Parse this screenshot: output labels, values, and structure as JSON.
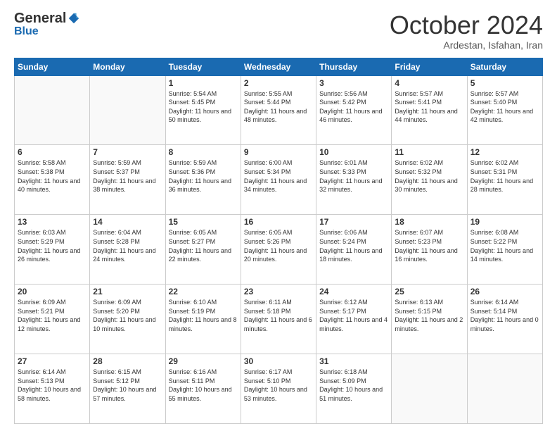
{
  "header": {
    "logo": {
      "general": "General",
      "blue": "Blue"
    },
    "title": "October 2024",
    "location": "Ardestan, Isfahan, Iran"
  },
  "days_of_week": [
    "Sunday",
    "Monday",
    "Tuesday",
    "Wednesday",
    "Thursday",
    "Friday",
    "Saturday"
  ],
  "weeks": [
    [
      {
        "day": "",
        "sunrise": "",
        "sunset": "",
        "daylight": ""
      },
      {
        "day": "",
        "sunrise": "",
        "sunset": "",
        "daylight": ""
      },
      {
        "day": "1",
        "sunrise": "Sunrise: 5:54 AM",
        "sunset": "Sunset: 5:45 PM",
        "daylight": "Daylight: 11 hours and 50 minutes."
      },
      {
        "day": "2",
        "sunrise": "Sunrise: 5:55 AM",
        "sunset": "Sunset: 5:44 PM",
        "daylight": "Daylight: 11 hours and 48 minutes."
      },
      {
        "day": "3",
        "sunrise": "Sunrise: 5:56 AM",
        "sunset": "Sunset: 5:42 PM",
        "daylight": "Daylight: 11 hours and 46 minutes."
      },
      {
        "day": "4",
        "sunrise": "Sunrise: 5:57 AM",
        "sunset": "Sunset: 5:41 PM",
        "daylight": "Daylight: 11 hours and 44 minutes."
      },
      {
        "day": "5",
        "sunrise": "Sunrise: 5:57 AM",
        "sunset": "Sunset: 5:40 PM",
        "daylight": "Daylight: 11 hours and 42 minutes."
      }
    ],
    [
      {
        "day": "6",
        "sunrise": "Sunrise: 5:58 AM",
        "sunset": "Sunset: 5:38 PM",
        "daylight": "Daylight: 11 hours and 40 minutes."
      },
      {
        "day": "7",
        "sunrise": "Sunrise: 5:59 AM",
        "sunset": "Sunset: 5:37 PM",
        "daylight": "Daylight: 11 hours and 38 minutes."
      },
      {
        "day": "8",
        "sunrise": "Sunrise: 5:59 AM",
        "sunset": "Sunset: 5:36 PM",
        "daylight": "Daylight: 11 hours and 36 minutes."
      },
      {
        "day": "9",
        "sunrise": "Sunrise: 6:00 AM",
        "sunset": "Sunset: 5:34 PM",
        "daylight": "Daylight: 11 hours and 34 minutes."
      },
      {
        "day": "10",
        "sunrise": "Sunrise: 6:01 AM",
        "sunset": "Sunset: 5:33 PM",
        "daylight": "Daylight: 11 hours and 32 minutes."
      },
      {
        "day": "11",
        "sunrise": "Sunrise: 6:02 AM",
        "sunset": "Sunset: 5:32 PM",
        "daylight": "Daylight: 11 hours and 30 minutes."
      },
      {
        "day": "12",
        "sunrise": "Sunrise: 6:02 AM",
        "sunset": "Sunset: 5:31 PM",
        "daylight": "Daylight: 11 hours and 28 minutes."
      }
    ],
    [
      {
        "day": "13",
        "sunrise": "Sunrise: 6:03 AM",
        "sunset": "Sunset: 5:29 PM",
        "daylight": "Daylight: 11 hours and 26 minutes."
      },
      {
        "day": "14",
        "sunrise": "Sunrise: 6:04 AM",
        "sunset": "Sunset: 5:28 PM",
        "daylight": "Daylight: 11 hours and 24 minutes."
      },
      {
        "day": "15",
        "sunrise": "Sunrise: 6:05 AM",
        "sunset": "Sunset: 5:27 PM",
        "daylight": "Daylight: 11 hours and 22 minutes."
      },
      {
        "day": "16",
        "sunrise": "Sunrise: 6:05 AM",
        "sunset": "Sunset: 5:26 PM",
        "daylight": "Daylight: 11 hours and 20 minutes."
      },
      {
        "day": "17",
        "sunrise": "Sunrise: 6:06 AM",
        "sunset": "Sunset: 5:24 PM",
        "daylight": "Daylight: 11 hours and 18 minutes."
      },
      {
        "day": "18",
        "sunrise": "Sunrise: 6:07 AM",
        "sunset": "Sunset: 5:23 PM",
        "daylight": "Daylight: 11 hours and 16 minutes."
      },
      {
        "day": "19",
        "sunrise": "Sunrise: 6:08 AM",
        "sunset": "Sunset: 5:22 PM",
        "daylight": "Daylight: 11 hours and 14 minutes."
      }
    ],
    [
      {
        "day": "20",
        "sunrise": "Sunrise: 6:09 AM",
        "sunset": "Sunset: 5:21 PM",
        "daylight": "Daylight: 11 hours and 12 minutes."
      },
      {
        "day": "21",
        "sunrise": "Sunrise: 6:09 AM",
        "sunset": "Sunset: 5:20 PM",
        "daylight": "Daylight: 11 hours and 10 minutes."
      },
      {
        "day": "22",
        "sunrise": "Sunrise: 6:10 AM",
        "sunset": "Sunset: 5:19 PM",
        "daylight": "Daylight: 11 hours and 8 minutes."
      },
      {
        "day": "23",
        "sunrise": "Sunrise: 6:11 AM",
        "sunset": "Sunset: 5:18 PM",
        "daylight": "Daylight: 11 hours and 6 minutes."
      },
      {
        "day": "24",
        "sunrise": "Sunrise: 6:12 AM",
        "sunset": "Sunset: 5:17 PM",
        "daylight": "Daylight: 11 hours and 4 minutes."
      },
      {
        "day": "25",
        "sunrise": "Sunrise: 6:13 AM",
        "sunset": "Sunset: 5:15 PM",
        "daylight": "Daylight: 11 hours and 2 minutes."
      },
      {
        "day": "26",
        "sunrise": "Sunrise: 6:14 AM",
        "sunset": "Sunset: 5:14 PM",
        "daylight": "Daylight: 11 hours and 0 minutes."
      }
    ],
    [
      {
        "day": "27",
        "sunrise": "Sunrise: 6:14 AM",
        "sunset": "Sunset: 5:13 PM",
        "daylight": "Daylight: 10 hours and 58 minutes."
      },
      {
        "day": "28",
        "sunrise": "Sunrise: 6:15 AM",
        "sunset": "Sunset: 5:12 PM",
        "daylight": "Daylight: 10 hours and 57 minutes."
      },
      {
        "day": "29",
        "sunrise": "Sunrise: 6:16 AM",
        "sunset": "Sunset: 5:11 PM",
        "daylight": "Daylight: 10 hours and 55 minutes."
      },
      {
        "day": "30",
        "sunrise": "Sunrise: 6:17 AM",
        "sunset": "Sunset: 5:10 PM",
        "daylight": "Daylight: 10 hours and 53 minutes."
      },
      {
        "day": "31",
        "sunrise": "Sunrise: 6:18 AM",
        "sunset": "Sunset: 5:09 PM",
        "daylight": "Daylight: 10 hours and 51 minutes."
      },
      {
        "day": "",
        "sunrise": "",
        "sunset": "",
        "daylight": ""
      },
      {
        "day": "",
        "sunrise": "",
        "sunset": "",
        "daylight": ""
      }
    ]
  ]
}
